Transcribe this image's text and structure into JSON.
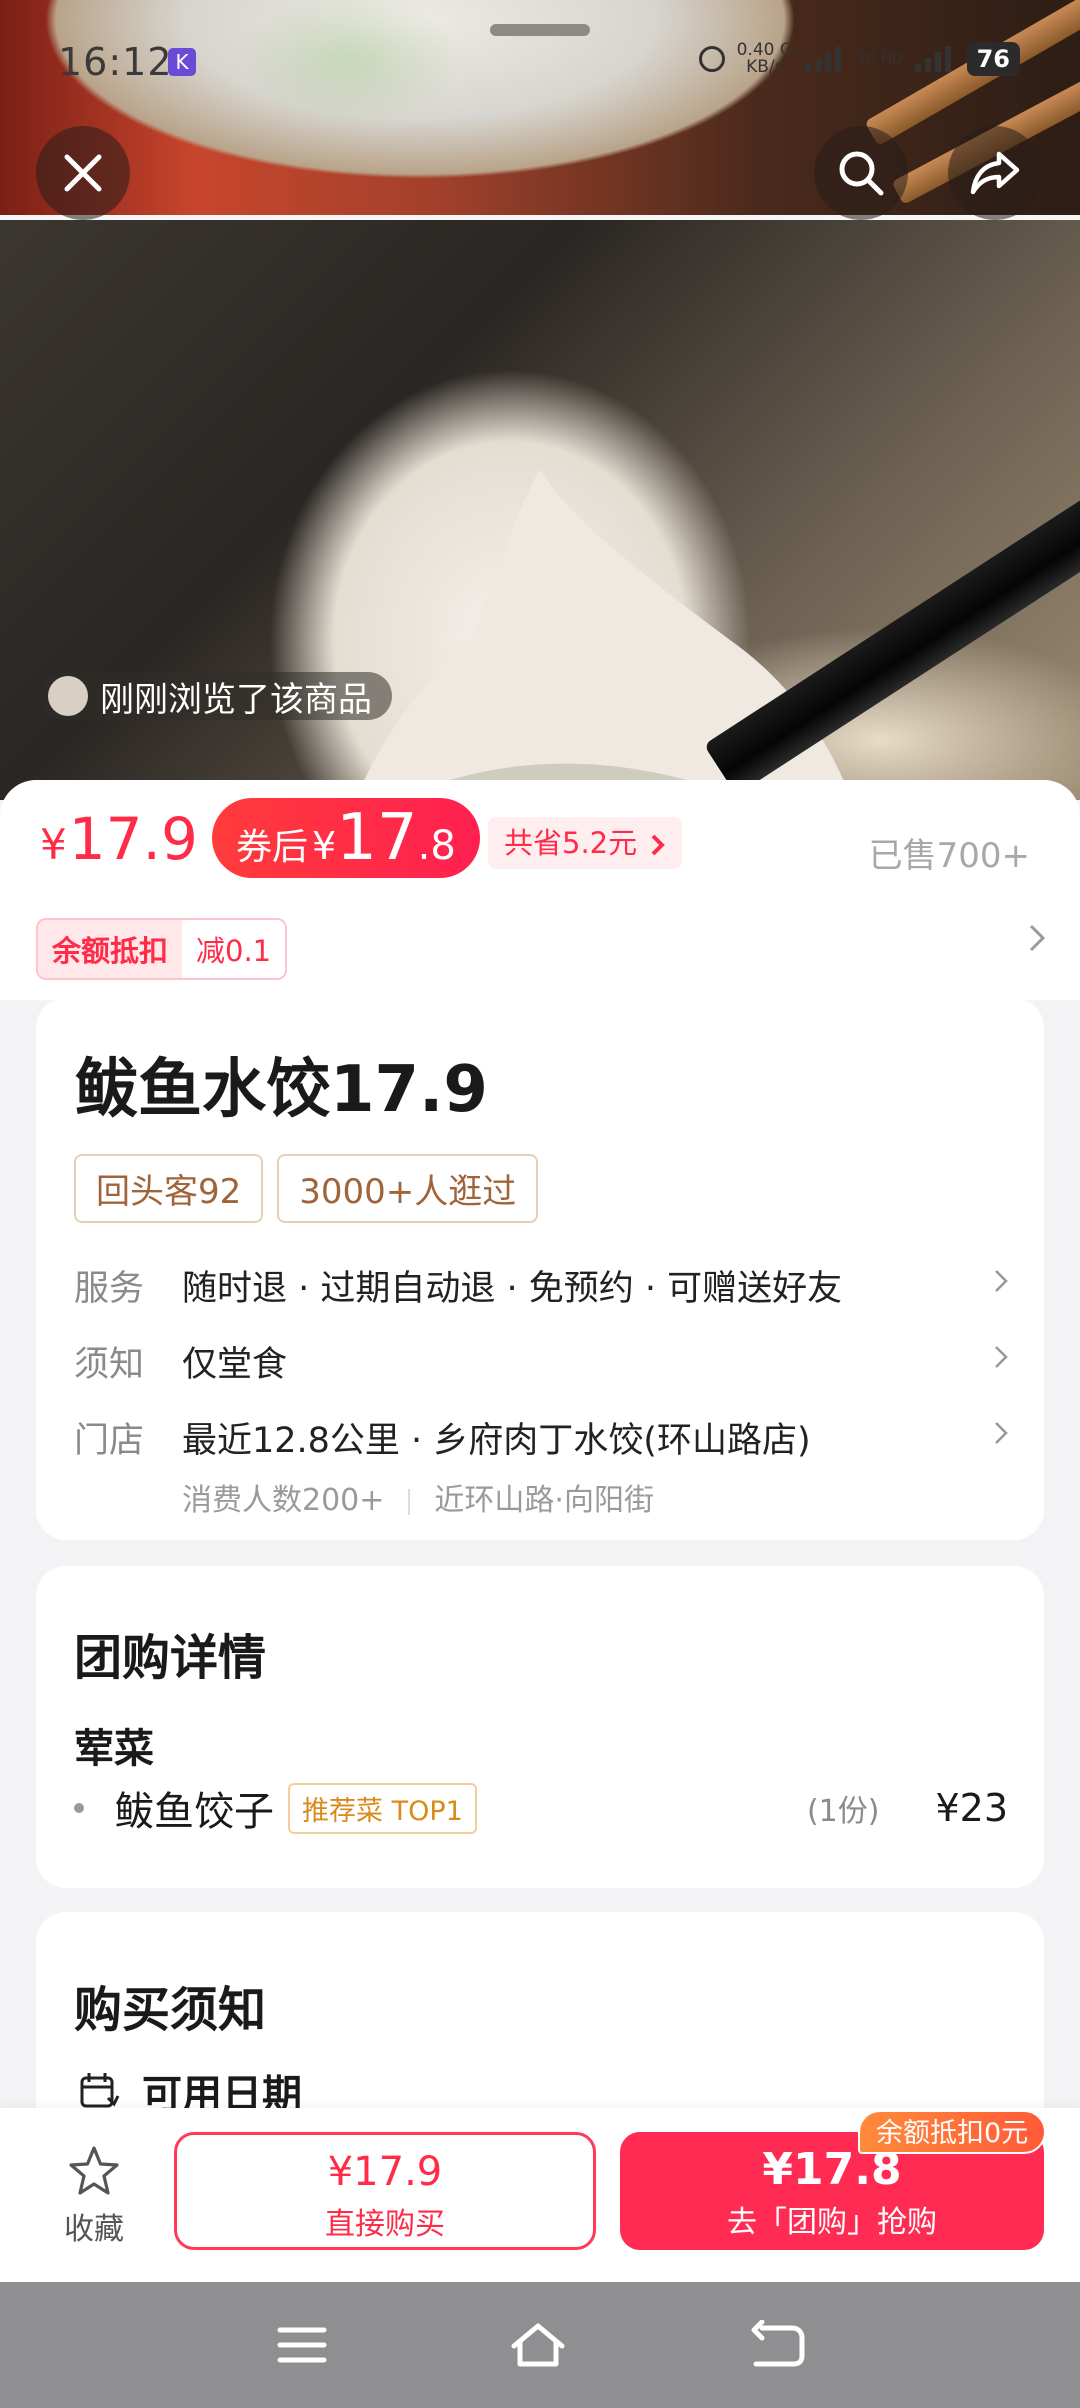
{
  "status_bar": {
    "time": "16:12",
    "app_badge": "K",
    "net_speed_top": "0.40",
    "net_speed_unit": "KB/s",
    "net_speed_g": "G",
    "signal_label": "5G HD",
    "battery": "76"
  },
  "hero": {
    "recent_view_text": "刚刚浏览了该商品"
  },
  "price": {
    "currency": "¥",
    "original": "17.9",
    "after_coupon_label": "券后",
    "after_coupon_int": "17",
    "after_coupon_dec": ".8",
    "save_text": "共省5.2元",
    "sold_text": "已售700+"
  },
  "balance": {
    "tag": "余额抵扣",
    "minus": "减0.1"
  },
  "product": {
    "title": "鲅鱼水饺17.9",
    "chips": [
      "回头客92",
      "3000+人逛过"
    ],
    "service_key": "服务",
    "service_val": "随时退 · 过期自动退 · 免预约 · 可赠送好友",
    "notice_key": "须知",
    "notice_val": "仅堂食",
    "store_key": "门店",
    "store_val": "最近12.8公里 · 乡府肉丁水饺(环山路店)",
    "store_sub_a": "消费人数200+",
    "store_sub_b": "近环山路·向阳街"
  },
  "group_detail": {
    "title": "团购详情",
    "category": "荤菜",
    "dish_name": "鲅鱼饺子",
    "dish_tag": "推荐菜 TOP1",
    "dish_portion": "(1份)",
    "dish_price": "¥23"
  },
  "purchase_notice": {
    "title": "购买须知",
    "date_label": "可用日期"
  },
  "bottom": {
    "fav_label": "收藏",
    "direct_price": "¥17.9",
    "direct_label": "直接购买",
    "group_price": "¥17.8",
    "group_label": "去「团购」抢购",
    "balance_badge": "余额抵扣0元"
  },
  "colors": {
    "accent_red": "#ff2b47",
    "chip_brown": "#a0643a",
    "tag_orange": "#d98a1b"
  }
}
